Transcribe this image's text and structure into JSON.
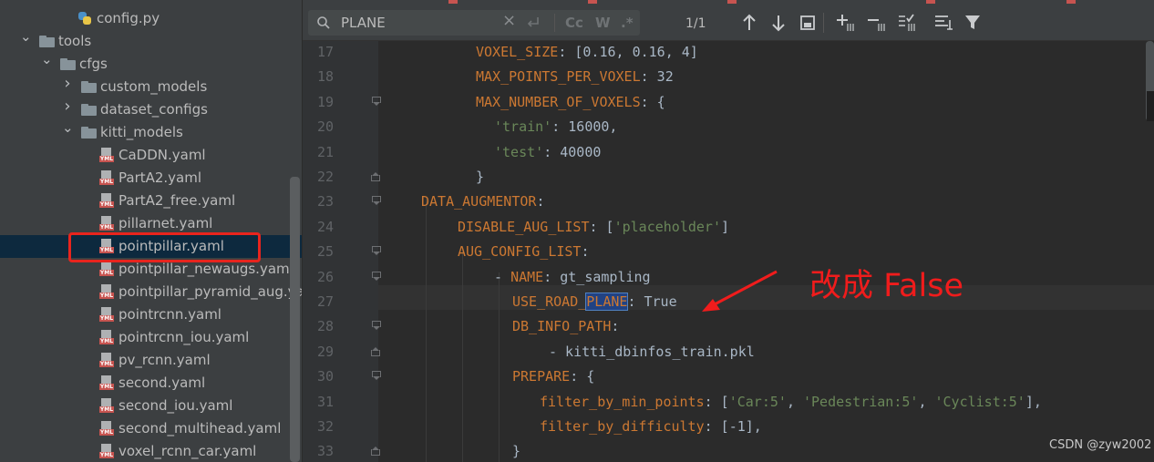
{
  "tree": {
    "items": [
      {
        "label": "config.py",
        "type": "python",
        "depth": 3,
        "expand": "none"
      },
      {
        "label": "tools",
        "type": "folder",
        "depth": 1,
        "expand": "open"
      },
      {
        "label": "cfgs",
        "type": "folder",
        "depth": 2,
        "expand": "open"
      },
      {
        "label": "custom_models",
        "type": "folder",
        "depth": 3,
        "expand": "closed"
      },
      {
        "label": "dataset_configs",
        "type": "folder",
        "depth": 3,
        "expand": "closed"
      },
      {
        "label": "kitti_models",
        "type": "folder",
        "depth": 3,
        "expand": "open"
      },
      {
        "label": "CaDDN.yaml",
        "type": "yaml",
        "depth": 4,
        "expand": "none"
      },
      {
        "label": "PartA2.yaml",
        "type": "yaml",
        "depth": 4,
        "expand": "none"
      },
      {
        "label": "PartA2_free.yaml",
        "type": "yaml",
        "depth": 4,
        "expand": "none"
      },
      {
        "label": "pillarnet.yaml",
        "type": "yaml",
        "depth": 4,
        "expand": "none"
      },
      {
        "label": "pointpillar.yaml",
        "type": "yaml",
        "depth": 4,
        "expand": "none",
        "selected": true
      },
      {
        "label": "pointpillar_newaugs.yaml",
        "type": "yaml",
        "depth": 4,
        "expand": "none"
      },
      {
        "label": "pointpillar_pyramid_aug.yaml",
        "type": "yaml",
        "depth": 4,
        "expand": "none"
      },
      {
        "label": "pointrcnn.yaml",
        "type": "yaml",
        "depth": 4,
        "expand": "none"
      },
      {
        "label": "pointrcnn_iou.yaml",
        "type": "yaml",
        "depth": 4,
        "expand": "none"
      },
      {
        "label": "pv_rcnn.yaml",
        "type": "yaml",
        "depth": 4,
        "expand": "none"
      },
      {
        "label": "second.yaml",
        "type": "yaml",
        "depth": 4,
        "expand": "none"
      },
      {
        "label": "second_iou.yaml",
        "type": "yaml",
        "depth": 4,
        "expand": "none"
      },
      {
        "label": "second_multihead.yaml",
        "type": "yaml",
        "depth": 4,
        "expand": "none"
      },
      {
        "label": "voxel_rcnn_car.yaml",
        "type": "yaml",
        "depth": 4,
        "expand": "none"
      }
    ],
    "yml_tag": "YML"
  },
  "find": {
    "query": "PLANE",
    "match_count": "1/1",
    "clear_icon": "×",
    "regex_label": ".*",
    "case_label": "Cc",
    "word_label": "W"
  },
  "editor": {
    "lines": [
      {
        "num": "17",
        "indent": 6,
        "tokens": [
          [
            "k",
            "VOXEL_SIZE"
          ],
          [
            "n",
            ": [0.16, 0.16, 4]"
          ]
        ]
      },
      {
        "num": "18",
        "indent": 6,
        "tokens": [
          [
            "k",
            "MAX_POINTS_PER_VOXEL"
          ],
          [
            "n",
            ": 32"
          ]
        ]
      },
      {
        "num": "19",
        "indent": 6,
        "tokens": [
          [
            "k",
            "MAX_NUMBER_OF_VOXELS"
          ],
          [
            "n",
            ": {"
          ]
        ],
        "fold": "down"
      },
      {
        "num": "20",
        "indent": 8,
        "tokens": [
          [
            "s",
            "'train'"
          ],
          [
            "n",
            ": 16000,"
          ]
        ]
      },
      {
        "num": "21",
        "indent": 8,
        "tokens": [
          [
            "s",
            "'test'"
          ],
          [
            "n",
            ": 40000"
          ]
        ]
      },
      {
        "num": "22",
        "indent": 6,
        "tokens": [
          [
            "n",
            "}"
          ]
        ],
        "fold": "up"
      },
      {
        "num": "23",
        "indent": 0,
        "tokens": [
          [
            "k",
            "DATA_AUGMENTOR"
          ],
          [
            "n",
            ":"
          ]
        ],
        "fold": "down"
      },
      {
        "num": "24",
        "indent": 4,
        "tokens": [
          [
            "k",
            "DISABLE_AUG_LIST"
          ],
          [
            "n",
            ": ["
          ],
          [
            "s",
            "'placeholder'"
          ],
          [
            "n",
            "]"
          ]
        ]
      },
      {
        "num": "25",
        "indent": 4,
        "tokens": [
          [
            "k",
            "AUG_CONFIG_LIST"
          ],
          [
            "n",
            ":"
          ]
        ],
        "fold": "down"
      },
      {
        "num": "26",
        "indent": 8,
        "tokens": [
          [
            "n",
            "- "
          ],
          [
            "k",
            "NAME"
          ],
          [
            "n",
            ": gt_sampling"
          ]
        ],
        "fold": "down"
      },
      {
        "num": "27",
        "indent": 10,
        "tokens": [
          [
            "k",
            "USE_ROAD_"
          ],
          [
            "sel",
            "PLANE"
          ],
          [
            "n",
            ": True"
          ]
        ]
      },
      {
        "num": "28",
        "indent": 10,
        "tokens": [
          [
            "k",
            "DB_INFO_PATH"
          ],
          [
            "n",
            ":"
          ]
        ],
        "fold": "down"
      },
      {
        "num": "29",
        "indent": 14,
        "tokens": [
          [
            "n",
            "- kitti_dbinfos_train.pkl"
          ]
        ],
        "fold": "up"
      },
      {
        "num": "30",
        "indent": 10,
        "tokens": [
          [
            "k",
            "PREPARE"
          ],
          [
            "n",
            ": {"
          ]
        ],
        "fold": "down"
      },
      {
        "num": "31",
        "indent": 13,
        "tokens": [
          [
            "k",
            "filter_by_min_points"
          ],
          [
            "n",
            ": ["
          ],
          [
            "s",
            "'Car:5'"
          ],
          [
            "n",
            ", "
          ],
          [
            "s",
            "'Pedestrian:5'"
          ],
          [
            "n",
            ", "
          ],
          [
            "s",
            "'Cyclist:5'"
          ],
          [
            "n",
            "],"
          ]
        ]
      },
      {
        "num": "32",
        "indent": 13,
        "tokens": [
          [
            "k",
            "filter_by_difficulty"
          ],
          [
            "n",
            ": [-1],"
          ]
        ]
      },
      {
        "num": "33",
        "indent": 10,
        "tokens": [
          [
            "n",
            "}"
          ]
        ],
        "fold": "up"
      }
    ]
  },
  "annotation": "改成 False",
  "watermark": "CSDN @zyw2002",
  "colors": {
    "keyword": "#cc7832",
    "string": "#6a8759",
    "annotation": "#f01c1c",
    "highlight_box": "#e8241d"
  }
}
